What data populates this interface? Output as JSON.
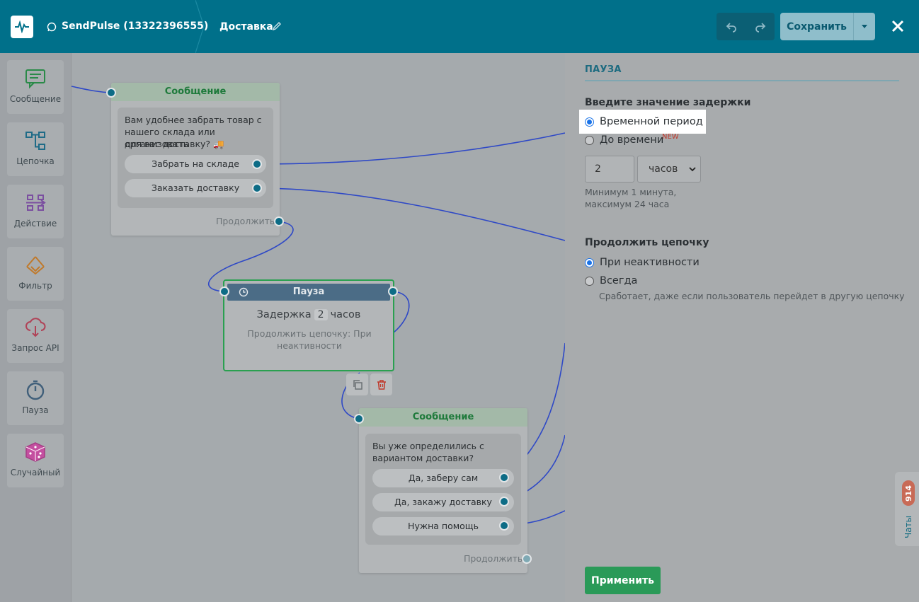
{
  "header": {
    "bot_name": "SendPulse (13322396555)",
    "flow_name": "Доставка",
    "save_label": "Сохранить"
  },
  "palette": {
    "items": [
      {
        "label": "Сообщение",
        "icon": "message-icon"
      },
      {
        "label": "Цепочка",
        "icon": "chain-icon"
      },
      {
        "label": "Действие",
        "icon": "action-icon"
      },
      {
        "label": "Фильтр",
        "icon": "filter-icon"
      },
      {
        "label": "Запрос API",
        "icon": "api-icon"
      },
      {
        "label": "Пауза",
        "icon": "stopwatch-icon"
      },
      {
        "label": "Случайный",
        "icon": "dice-icon"
      }
    ]
  },
  "canvas": {
    "node1": {
      "title": "Сообщение",
      "text_line1": "Вам удобнее забрать товар с",
      "text_line2": "нашего склада или организовать",
      "text_line3": "для вас доставку? 🚚",
      "buttons": [
        "Забрать на складе",
        "Заказать доставку"
      ],
      "continue": "Продолжить"
    },
    "pause_node": {
      "title": "Пауза",
      "delay_prefix": "Задержка",
      "delay_value": "2",
      "delay_unit": "часов",
      "sub_line1": "Продолжить цепочку: При",
      "sub_line2": "неактивности"
    },
    "node2": {
      "title": "Сообщение",
      "text_line1": "Вы уже определились с",
      "text_line2": "вариантом доставки?",
      "buttons": [
        "Да, заберу сам",
        "Да, закажу доставку",
        "Нужна помощь"
      ],
      "continue": "Продолжить"
    }
  },
  "panel": {
    "title": "ПАУЗА",
    "delay_label": "Введите значение задержки",
    "delay_options": [
      "Временной период",
      "До времени"
    ],
    "new_badge": "NEW",
    "delay_value": "2",
    "delay_unit": "часов",
    "hint_line1": "Минимум 1 минута,",
    "hint_line2": "максимум 24 часа",
    "continue_label": "Продолжить цепочку",
    "continue_options": [
      "При неактивности",
      "Всегда"
    ],
    "always_hint": "Сработает, даже если пользователь перейдет в другую цепочку",
    "apply_label": "Применить"
  },
  "chats": {
    "count": "914",
    "label": "Чаты"
  }
}
